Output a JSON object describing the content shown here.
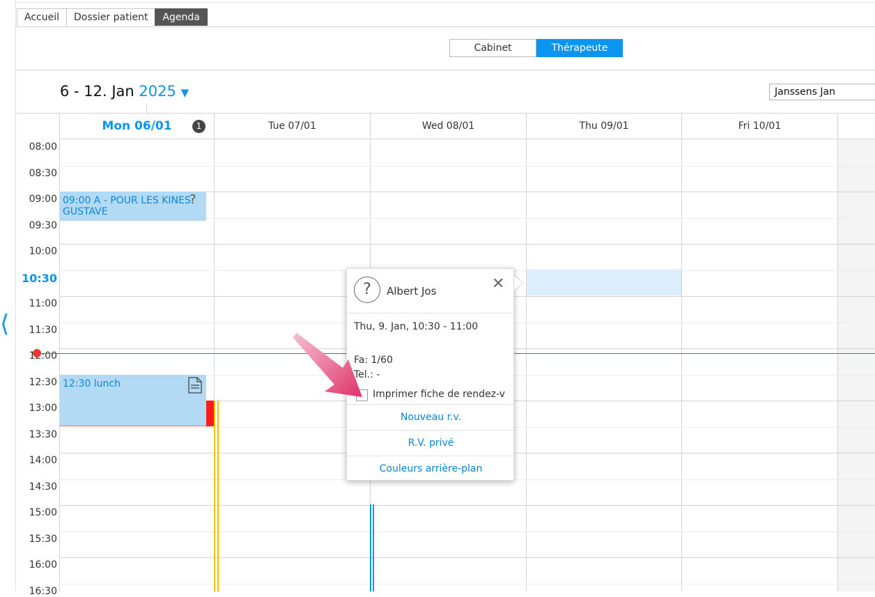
{
  "tabs": [
    "Accueil",
    "Dossier patient",
    "Agenda"
  ],
  "view_toggle": {
    "cabinet": "Cabinet",
    "therapeute": "Thérapeute"
  },
  "date_range": {
    "range": "6 - 12. Jan",
    "year": "2025"
  },
  "therapist_select": "Janssens Jan",
  "days": [
    {
      "label": "Mon 06/01",
      "badge": "1"
    },
    {
      "label": "Tue 07/01"
    },
    {
      "label": "Wed 08/01"
    },
    {
      "label": "Thu 09/01"
    },
    {
      "label": "Fri 10/01"
    }
  ],
  "times": [
    "08:00",
    "08:30",
    "09:00",
    "09:30",
    "10:00",
    "10:30",
    "11:00",
    "11:30",
    "12:00",
    "12:30",
    "13:00",
    "13:30",
    "14:00",
    "14:30",
    "15:00",
    "15:30",
    "16:00",
    "16:30"
  ],
  "current_time_label": "10:30",
  "events": [
    {
      "line1": "09:00 A - POUR LES KINES",
      "line2": "GUSTAVE",
      "icon": "question-icon"
    },
    {
      "line1": "12:30 lunch",
      "icon": "document-icon"
    }
  ],
  "popup": {
    "name": "Albert Jos",
    "datetime": "Thu, 9. Jan, 10:30 - 11:00",
    "fa": "Fa: 1/60",
    "tel": "Tel.: -",
    "print_label": "Imprimer fiche de rendez-v",
    "actions": [
      "Nouveau r.v.",
      "R.V. privé",
      "Couleurs arrière-plan"
    ]
  },
  "colors": {
    "accent": "#0a96f0",
    "event_bg": "#b3daf5",
    "now_line": "#e53935"
  }
}
